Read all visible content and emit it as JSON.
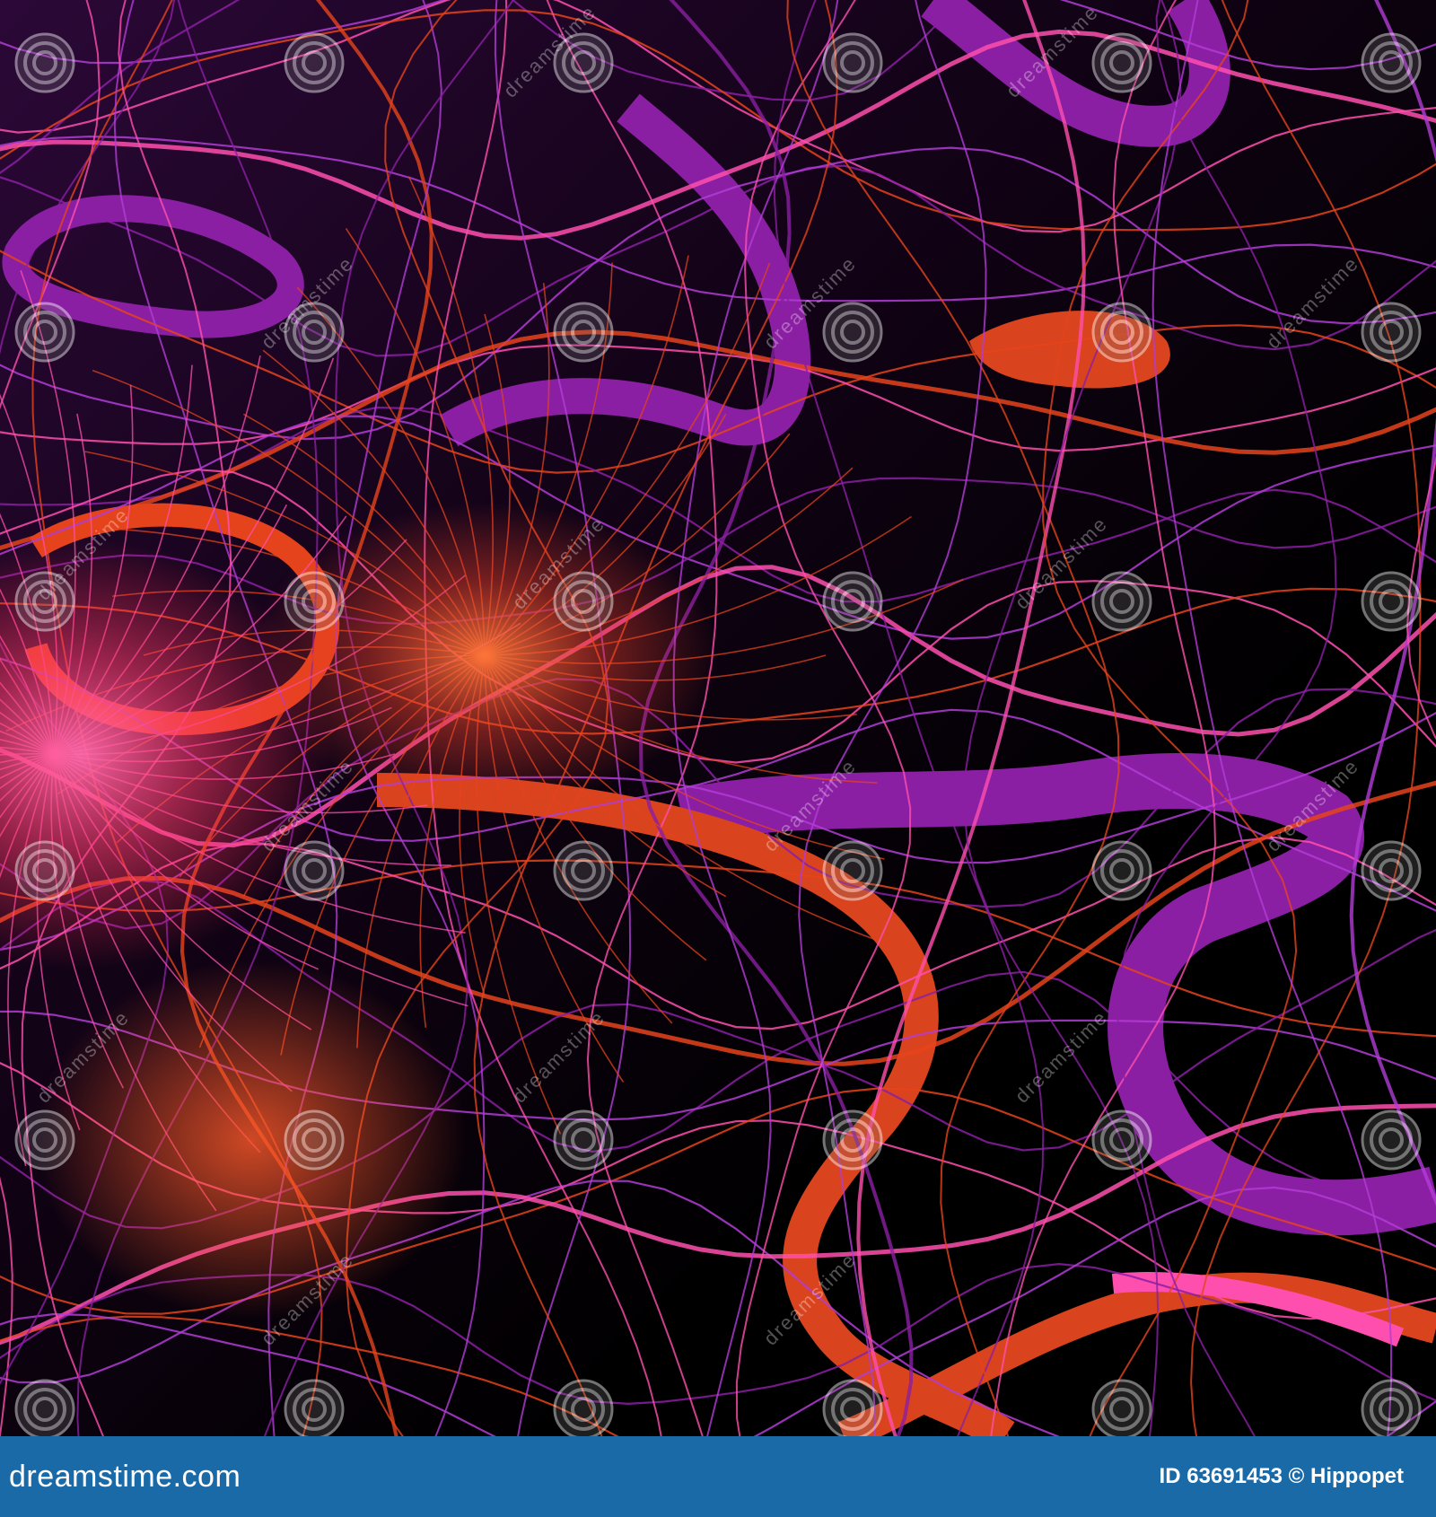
{
  "artwork": {
    "subject": "abstract wavy contour lines",
    "colors": {
      "background": "#000000",
      "violet": "#8b1fa3",
      "light_violet": "#b23cd6",
      "orange": "#e5431c",
      "pink": "#ff4fae",
      "glow": "#ff5a8a"
    }
  },
  "watermark": {
    "text": "dreamstime",
    "icon": "spiral-logo-icon"
  },
  "footer": {
    "background": "#1b6aa8",
    "brand": "dreamstime.com",
    "stock_id": "ID 63691453 © Hippopet"
  }
}
